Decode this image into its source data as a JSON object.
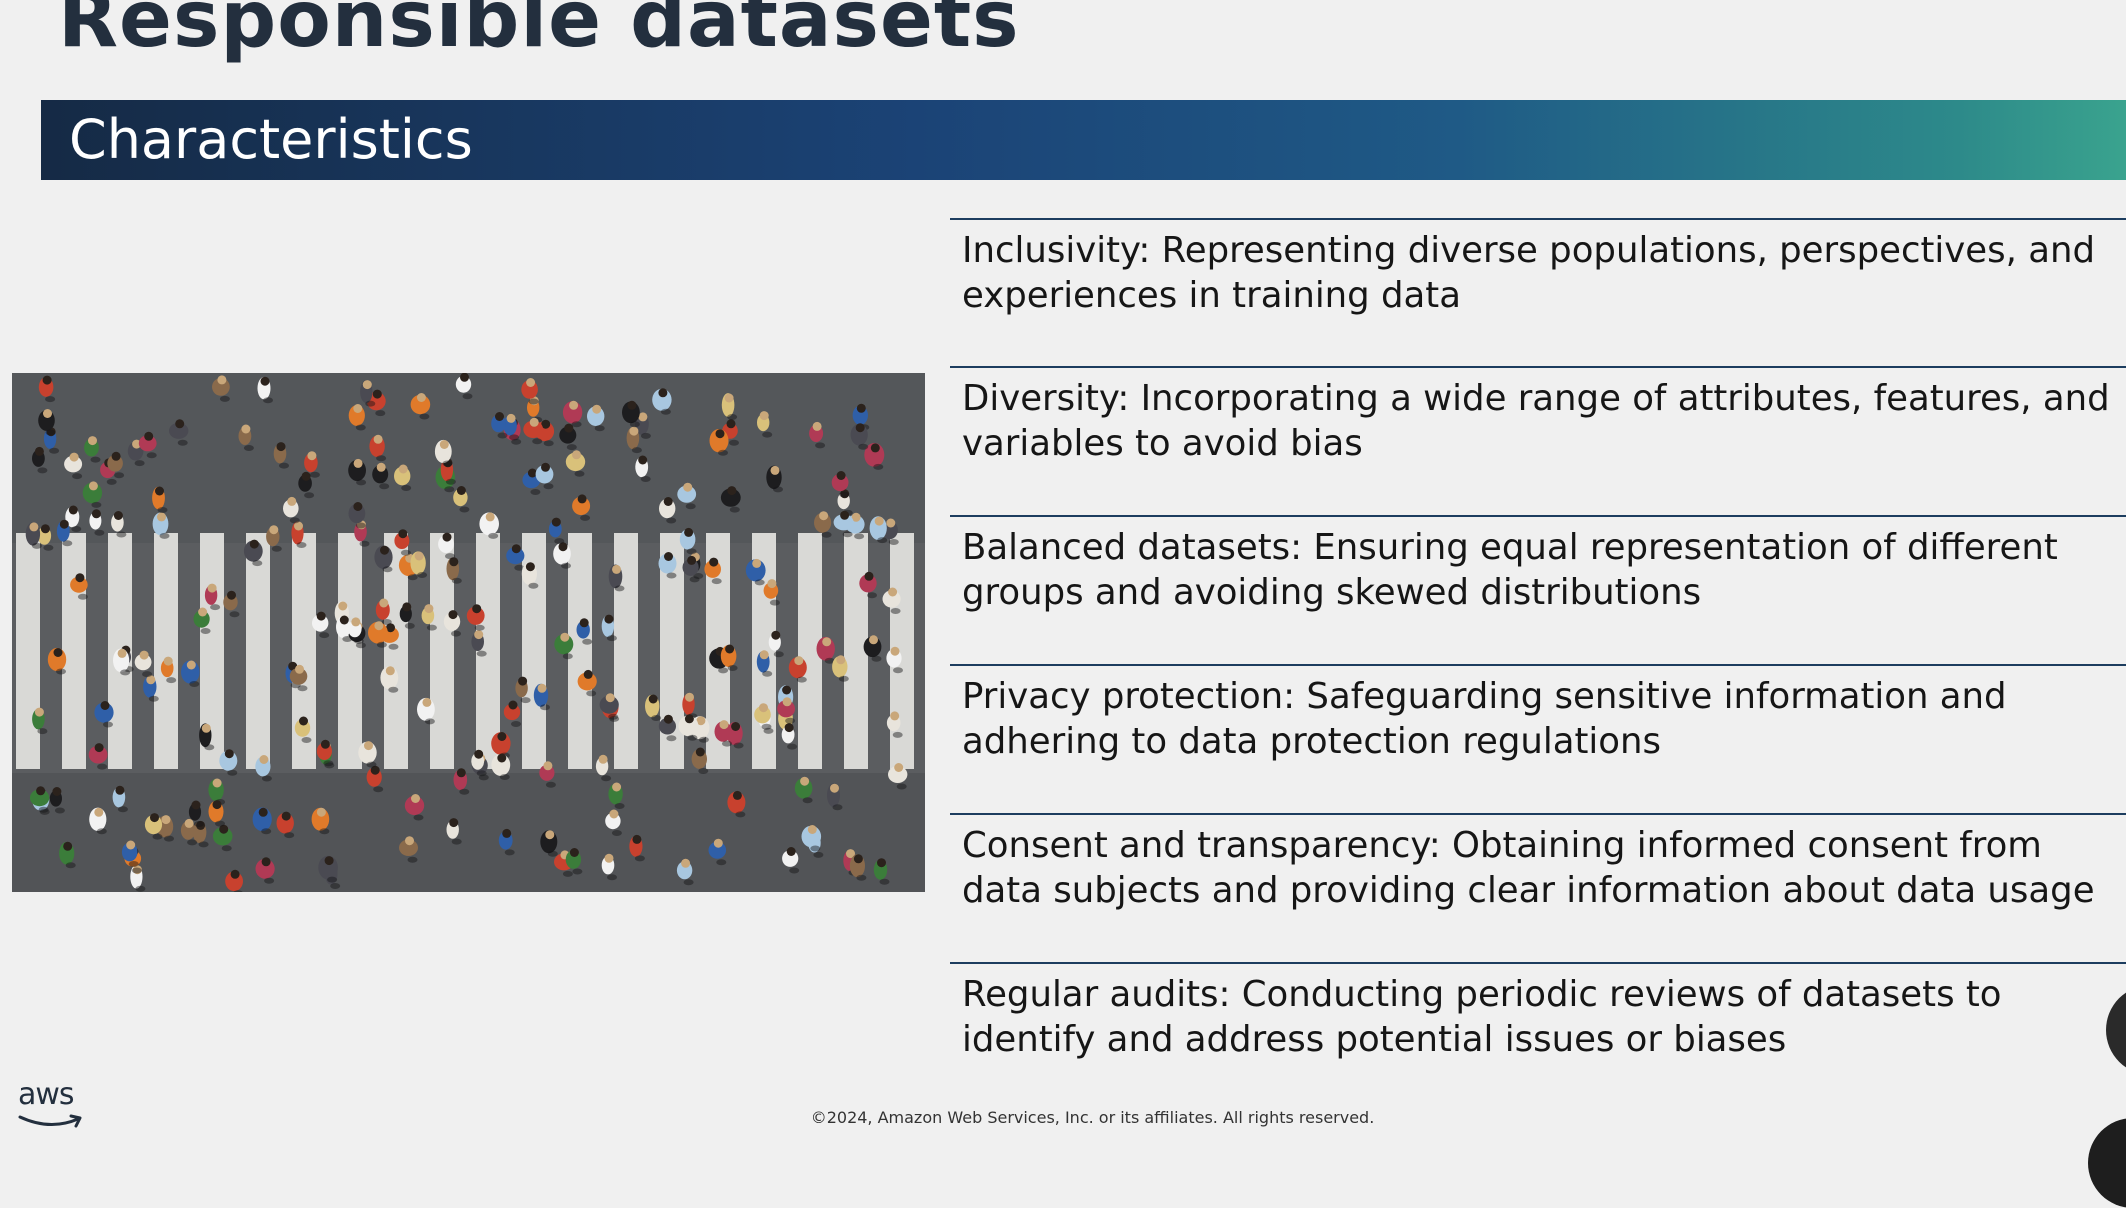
{
  "slide": {
    "title": "Responsible datasets",
    "section_header": "Characteristics",
    "image_alt": "Aerial view of crowd crossing a zebra crosswalk",
    "items": [
      {
        "text": "Inclusivity: Representing diverse populations, perspectives, and experiences in training data"
      },
      {
        "text": "Diversity: Incorporating a wide range of attributes, features, and variables to avoid bias"
      },
      {
        "text": "Balanced datasets: Ensuring equal representation of different groups and avoiding skewed distributions"
      },
      {
        "text": "Privacy protection: Safeguarding sensitive information and adhering to data protection regulations"
      },
      {
        "text": "Consent and transparency: Obtaining informed consent from data subjects and providing clear information about data usage"
      },
      {
        "text": "Regular audits: Conducting periodic reviews of datasets to identify and address potential issues or biases"
      }
    ],
    "logo_text": "aws",
    "footer": "©2024, Amazon Web Services, Inc. or its affiliates. All rights reserved.",
    "colors": {
      "title": "#232f3e",
      "band_start": "#152a45",
      "band_end": "#3aa38e",
      "rule": "#1d3d5f",
      "background": "#f0f0f0"
    }
  }
}
